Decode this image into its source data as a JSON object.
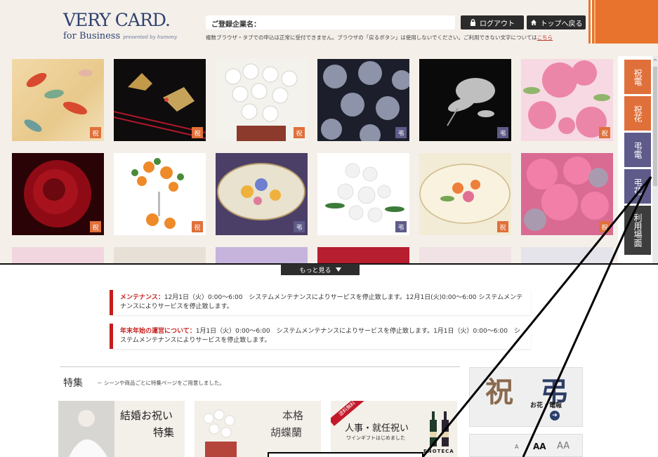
{
  "header": {
    "logo_main": "VERY CARD.",
    "logo_sub": "for Business",
    "logo_presented": "presented by humony",
    "company_label": "ご登録企業名：",
    "logout_label": "ログアウト",
    "top_label": "トップへ戻る",
    "notice_text": "複数ブラウザ・タブでの申込は正常に受付できません。ブラウザの「戻るボタン」は使用しないでください。ご利用できない文字については",
    "notice_link": "こちら"
  },
  "gallery": {
    "tiles": [
      {
        "tag": "祝",
        "kind": "celeb"
      },
      {
        "tag": "祝",
        "kind": "celeb"
      },
      {
        "tag": "祝",
        "kind": "celeb"
      },
      {
        "tag": "弔",
        "kind": "cond"
      },
      {
        "tag": "弔",
        "kind": "cond"
      },
      {
        "tag": "祝",
        "kind": "celeb"
      },
      {
        "tag": "祝",
        "kind": "celeb"
      },
      {
        "tag": "祝",
        "kind": "celeb"
      },
      {
        "tag": "弔",
        "kind": "cond"
      },
      {
        "tag": "弔",
        "kind": "cond"
      },
      {
        "tag": "祝",
        "kind": "celeb"
      },
      {
        "tag": "祝",
        "kind": "celeb"
      }
    ],
    "more_label": "もっと見る"
  },
  "side_nav": {
    "items": [
      {
        "label": "祝電",
        "color": "#e0703a"
      },
      {
        "label": "祝花",
        "color": "#e0703a"
      },
      {
        "label": "弔電",
        "color": "#5e5b8a"
      },
      {
        "label": "弔花",
        "color": "#5e5b8a"
      },
      {
        "label": "利用場面",
        "color": "#3d3d3d"
      }
    ]
  },
  "maintenance": [
    {
      "title": "メンテナンス：",
      "body": "12月1日（火）0:00〜6:00　システムメンテナンスによりサービスを停止致します。12月1日(火)0:00〜6:00 システムメンテナンスによりサービスを停止致します。"
    },
    {
      "title": "年末年始の運営について：",
      "body": "1月1日（火）0:00〜6:00　システムメンテナンスによりサービスを停止致します。1月1日（火）0:00〜6:00　システムメンテナンスによりサービスを停止致します。"
    }
  ],
  "special": {
    "title": "特集",
    "desc": "－ シーンや商品ごとに特集ページをご用意しました。",
    "cards": [
      {
        "line1": "結婚お祝い",
        "line2": "特集"
      },
      {
        "line1": "本格",
        "line2": "胡蝶蘭"
      },
      {
        "badge": "送料無料",
        "line1": "人事・就任祝い",
        "line2": "ワインギフトはじめました",
        "brand": "ENOTECA"
      }
    ]
  },
  "banner": {
    "kanji_left": "祝",
    "kanji_right": "弔",
    "text": "お花・電報"
  },
  "font_size": {
    "small": "A",
    "mid": "AA",
    "large": "AA"
  },
  "colors": {
    "accent": "#e8732c",
    "brand": "#2f4270",
    "celeb": "#e0703a",
    "cond": "#5e5b8a",
    "alert": "#c61d1d"
  }
}
